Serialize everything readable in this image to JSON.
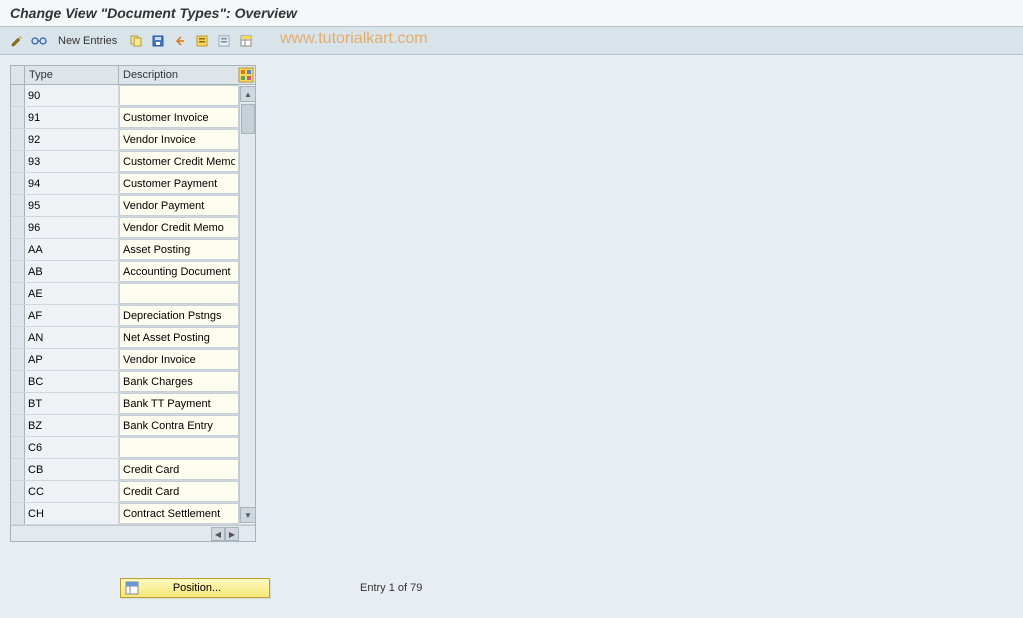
{
  "title": "Change View \"Document Types\": Overview",
  "watermark": "www.tutorialkart.com",
  "toolbar": {
    "new_entries": "New Entries"
  },
  "table": {
    "columns": {
      "type": "Type",
      "description": "Description"
    },
    "rows": [
      {
        "type": "90",
        "desc": ""
      },
      {
        "type": "91",
        "desc": "Customer Invoice"
      },
      {
        "type": "92",
        "desc": "Vendor Invoice"
      },
      {
        "type": "93",
        "desc": "Customer Credit Memo"
      },
      {
        "type": "94",
        "desc": "Customer Payment"
      },
      {
        "type": "95",
        "desc": "Vendor Payment"
      },
      {
        "type": "96",
        "desc": "Vendor Credit Memo"
      },
      {
        "type": "AA",
        "desc": "Asset Posting"
      },
      {
        "type": "AB",
        "desc": "Accounting Document"
      },
      {
        "type": "AE",
        "desc": ""
      },
      {
        "type": "AF",
        "desc": "Depreciation Pstngs"
      },
      {
        "type": "AN",
        "desc": "Net Asset Posting"
      },
      {
        "type": "AP",
        "desc": "Vendor Invoice"
      },
      {
        "type": "BC",
        "desc": "Bank Charges"
      },
      {
        "type": "BT",
        "desc": "Bank TT Payment"
      },
      {
        "type": "BZ",
        "desc": "Bank Contra Entry"
      },
      {
        "type": "C6",
        "desc": ""
      },
      {
        "type": "CB",
        "desc": "Credit Card"
      },
      {
        "type": "CC",
        "desc": "Credit Card"
      },
      {
        "type": "CH",
        "desc": "Contract Settlement"
      }
    ]
  },
  "footer": {
    "position_label": "Position...",
    "entry_text": "Entry 1 of 79"
  }
}
